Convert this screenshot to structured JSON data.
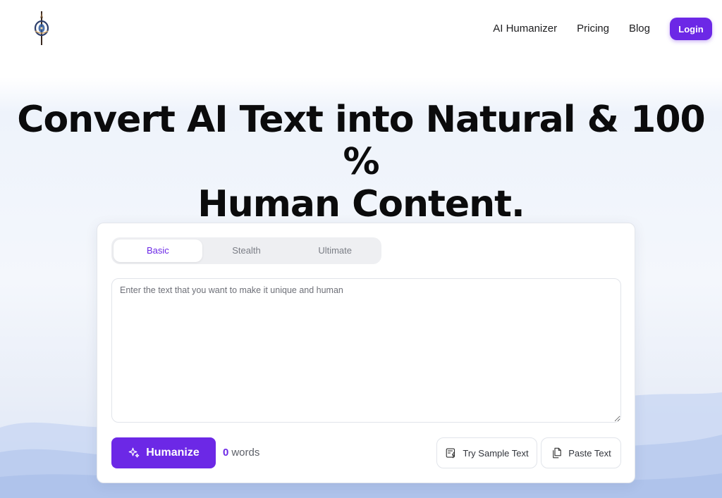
{
  "nav": {
    "links": [
      "AI Humanizer",
      "Pricing",
      "Blog"
    ],
    "login_label": "Login"
  },
  "hero": {
    "line1": "Convert AI Text into Natural & 100 %",
    "line2": "Human Content."
  },
  "tabs": [
    {
      "label": "Basic",
      "active": true
    },
    {
      "label": "Stealth",
      "active": false
    },
    {
      "label": "Ultimate",
      "active": false
    }
  ],
  "editor": {
    "placeholder": "Enter the text that you want to make it unique and human",
    "value": ""
  },
  "actions": {
    "humanize_label": "Humanize",
    "word_count": "0",
    "word_unit": "words",
    "sample_label": "Try Sample Text",
    "paste_label": "Paste Text"
  },
  "colors": {
    "accent": "#6c28e6",
    "background": "#eef3fb"
  },
  "icons": {
    "logo": "compass-pen-logo",
    "humanize": "sparkles-icon",
    "sample": "document-lightning-icon",
    "paste": "copy-icon"
  }
}
